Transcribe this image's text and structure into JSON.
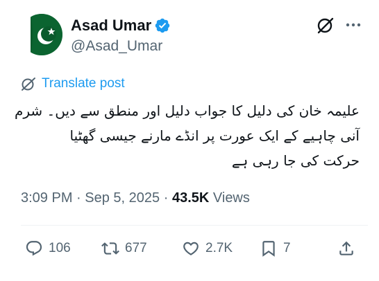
{
  "author": {
    "display_name": "Asad Umar",
    "handle": "@Asad_Umar",
    "verified": true,
    "avatar_icon": "pakistan-flag-avatar"
  },
  "header_icons": {
    "grok": "grok-icon",
    "more": "more-options-icon"
  },
  "translate": {
    "label": "Translate post"
  },
  "post": {
    "lines": [
      "علیمہ خان کی دلیل کا جواب دلیل اور منطق سے دیں۔ شرم",
      "آنی چاہیے کے ایک عورت پر انڈے مارنے جیسی گھٹیا",
      "حرکت کی جا رہی ہے"
    ]
  },
  "meta": {
    "time": "3:09 PM",
    "separator": "·",
    "date": "Sep 5, 2025",
    "views_count": "43.5K",
    "views_label": "Views"
  },
  "actions": {
    "replies": "106",
    "reposts": "677",
    "likes": "2.7K",
    "bookmarks": "7"
  },
  "colors": {
    "accent": "#1d9bf0",
    "text": "#0f1419",
    "secondary": "#536471",
    "flag_green": "#01411c"
  }
}
